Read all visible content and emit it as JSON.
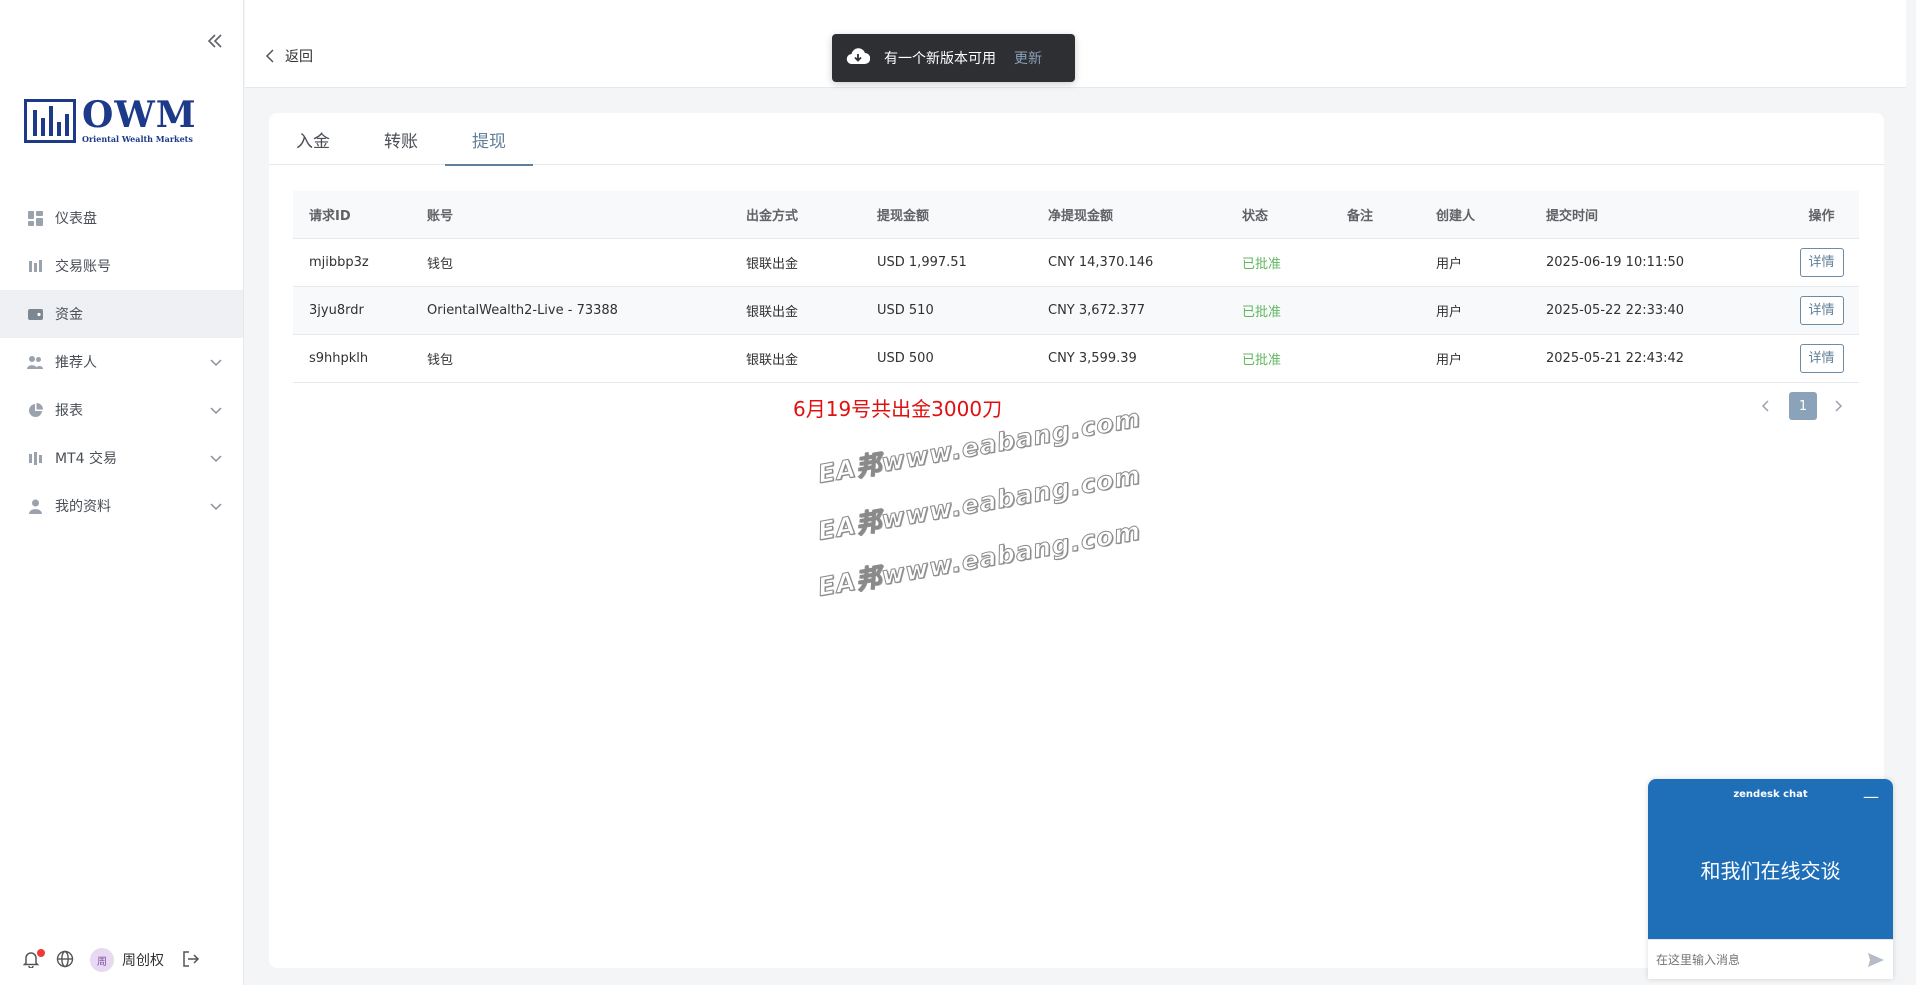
{
  "sidebar": {
    "logo_title": "OWM",
    "logo_sub": "Oriental Wealth Markets",
    "items": [
      {
        "label": "仪表盘",
        "icon": "dashboard-icon"
      },
      {
        "label": "交易账号",
        "icon": "accounts-icon"
      },
      {
        "label": "资金",
        "icon": "wallet-icon"
      },
      {
        "label": "推荐人",
        "icon": "users-icon"
      },
      {
        "label": "报表",
        "icon": "pie-chart-icon"
      },
      {
        "label": "MT4 交易",
        "icon": "candles-icon"
      },
      {
        "label": "我的资料",
        "icon": "user-icon"
      }
    ],
    "footer": {
      "avatar_initial": "周",
      "username": "周创权"
    }
  },
  "topbar": {
    "back_label": "返回"
  },
  "toast": {
    "message": "有一个新版本可用",
    "action": "更新"
  },
  "tabs": [
    "入金",
    "转账",
    "提现"
  ],
  "table": {
    "headers": [
      "请求ID",
      "账号",
      "出金方式",
      "提现金额",
      "净提现金额",
      "状态",
      "备注",
      "创建人",
      "提交时间",
      "操作"
    ],
    "rows": [
      {
        "id": "mjibbp3z",
        "account": "钱包",
        "method": "银联出金",
        "amount": "USD 1,997.51",
        "net": "CNY 14,370.146",
        "status": "已批准",
        "note": "",
        "creator": "用户",
        "time": "2025-06-19 10:11:50",
        "action": "详情"
      },
      {
        "id": "3jyu8rdr",
        "account": "OrientalWealth2-Live - 73388",
        "method": "银联出金",
        "amount": "USD 510",
        "net": "CNY 3,672.377",
        "status": "已批准",
        "note": "",
        "creator": "用户",
        "time": "2025-05-22 22:33:40",
        "action": "详情"
      },
      {
        "id": "s9hhpklh",
        "account": "钱包",
        "method": "银联出金",
        "amount": "USD 500",
        "net": "CNY 3,599.39",
        "status": "已批准",
        "note": "",
        "creator": "用户",
        "time": "2025-05-21 22:43:42",
        "action": "详情"
      }
    ]
  },
  "pagination": {
    "current": "1"
  },
  "annotation": "6月19号共出金3000刀",
  "watermark": "EA邦www.eabang.com",
  "chat": {
    "brand": "zendesk chat",
    "greeting": "和我们在线交谈",
    "placeholder": "在这里输入消息"
  },
  "colors": {
    "accent": "#5f7f9a",
    "status_approved": "#5fb85f",
    "chat_blue": "#1f6fb8",
    "annotation_red": "#e01010"
  }
}
